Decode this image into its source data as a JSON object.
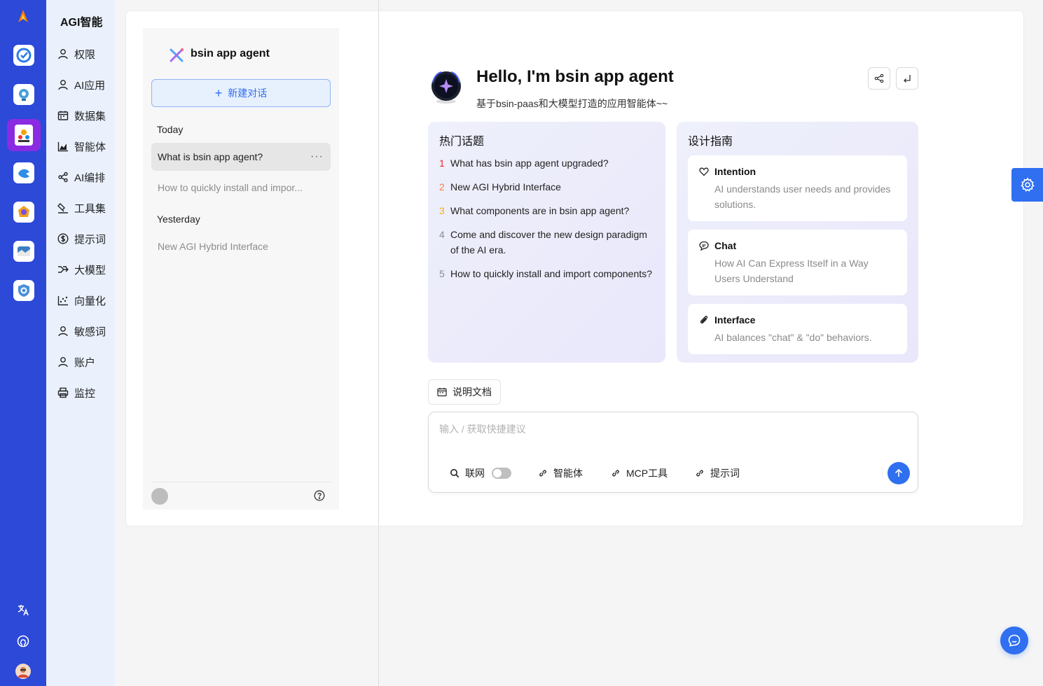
{
  "menu": {
    "title": "AGI智能",
    "items": [
      {
        "label": "权限",
        "icon": "user-icon"
      },
      {
        "label": "AI应用",
        "icon": "user-icon"
      },
      {
        "label": "数据集",
        "icon": "calendar-icon"
      },
      {
        "label": "智能体",
        "icon": "area-chart-icon"
      },
      {
        "label": "AI编排",
        "icon": "share-icon"
      },
      {
        "label": "工具集",
        "icon": "format-painter-icon"
      },
      {
        "label": "提示词",
        "icon": "dollar-icon"
      },
      {
        "label": "大模型",
        "icon": "merge-icon"
      },
      {
        "label": "向量化",
        "icon": "dot-chart-icon"
      },
      {
        "label": "敏感词",
        "icon": "user-icon"
      },
      {
        "label": "账户",
        "icon": "user-icon"
      },
      {
        "label": "监控",
        "icon": "printer-icon"
      }
    ]
  },
  "conversations": {
    "title": "bsin app agent",
    "new_label": "新建对话",
    "groups": [
      {
        "label": "Today",
        "items": [
          "What is bsin app agent?",
          "How to quickly install and impor..."
        ]
      },
      {
        "label": "Yesterday",
        "items": [
          "New AGI Hybrid Interface"
        ]
      }
    ]
  },
  "welcome": {
    "title": "Hello, I'm bsin app agent",
    "subtitle": "基于bsin-paas和大模型打造的应用智能体~~"
  },
  "hot_topics": {
    "title": "热门话题",
    "items": [
      {
        "num": "1",
        "text": "What has bsin app agent upgraded?",
        "color": "#f5222d"
      },
      {
        "num": "2",
        "text": "New AGI Hybrid Interface",
        "color": "#ff7a45"
      },
      {
        "num": "3",
        "text": "What components are in bsin app agent?",
        "color": "#faad14"
      },
      {
        "num": "4",
        "text": "Come and discover the new design paradigm of the AI era.",
        "color": "#8c8c8c"
      },
      {
        "num": "5",
        "text": "How to quickly install and import components?",
        "color": "#8c8c8c"
      }
    ]
  },
  "design_guide": {
    "title": "设计指南",
    "items": [
      {
        "name": "Intention",
        "desc": "AI understands user needs and provides solutions.",
        "icon": "heart-icon"
      },
      {
        "name": "Chat",
        "desc": "How AI Can Express Itself in a Way Users Understand",
        "icon": "comment-icon"
      },
      {
        "name": "Interface",
        "desc": "AI balances \"chat\" & \"do\" behaviors.",
        "icon": "paperclip-icon"
      }
    ]
  },
  "doc_button": "说明文档",
  "input": {
    "placeholder": "输入 / 获取快捷建议",
    "web_search": "联网",
    "agent": "智能体",
    "mcp": "MCP工具",
    "prompt": "提示词"
  },
  "colors": {
    "primary": "#2f6ff0",
    "appbar": "#2c49d8",
    "menu_bg": "#eaf1fd"
  }
}
